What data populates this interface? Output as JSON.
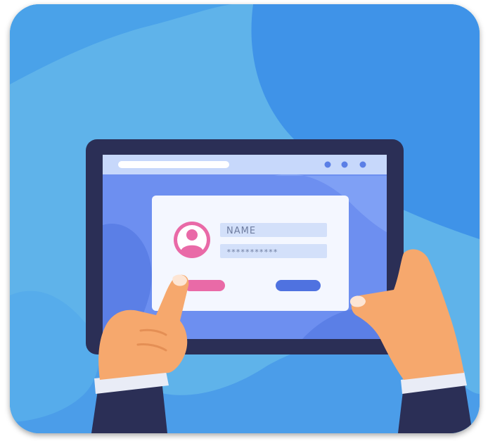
{
  "illustration": {
    "login_card": {
      "name_field": {
        "placeholder": "NAME"
      },
      "password_field": {
        "value": "***********"
      },
      "avatar_icon": "user-avatar-icon",
      "left_button_color": "#e96aa7",
      "right_button_color": "#4f72e0"
    },
    "browser_bar": {
      "window_dots": 3
    }
  },
  "colors": {
    "background_light": "#5fb3ea",
    "background_dark": "#3f93e8",
    "tablet_frame": "#2b2f56",
    "tablet_screen": "#6d8ff0",
    "avatar_pink": "#e96aa7",
    "skin": "#f6a86d",
    "sleeve": "#2b2f56"
  }
}
